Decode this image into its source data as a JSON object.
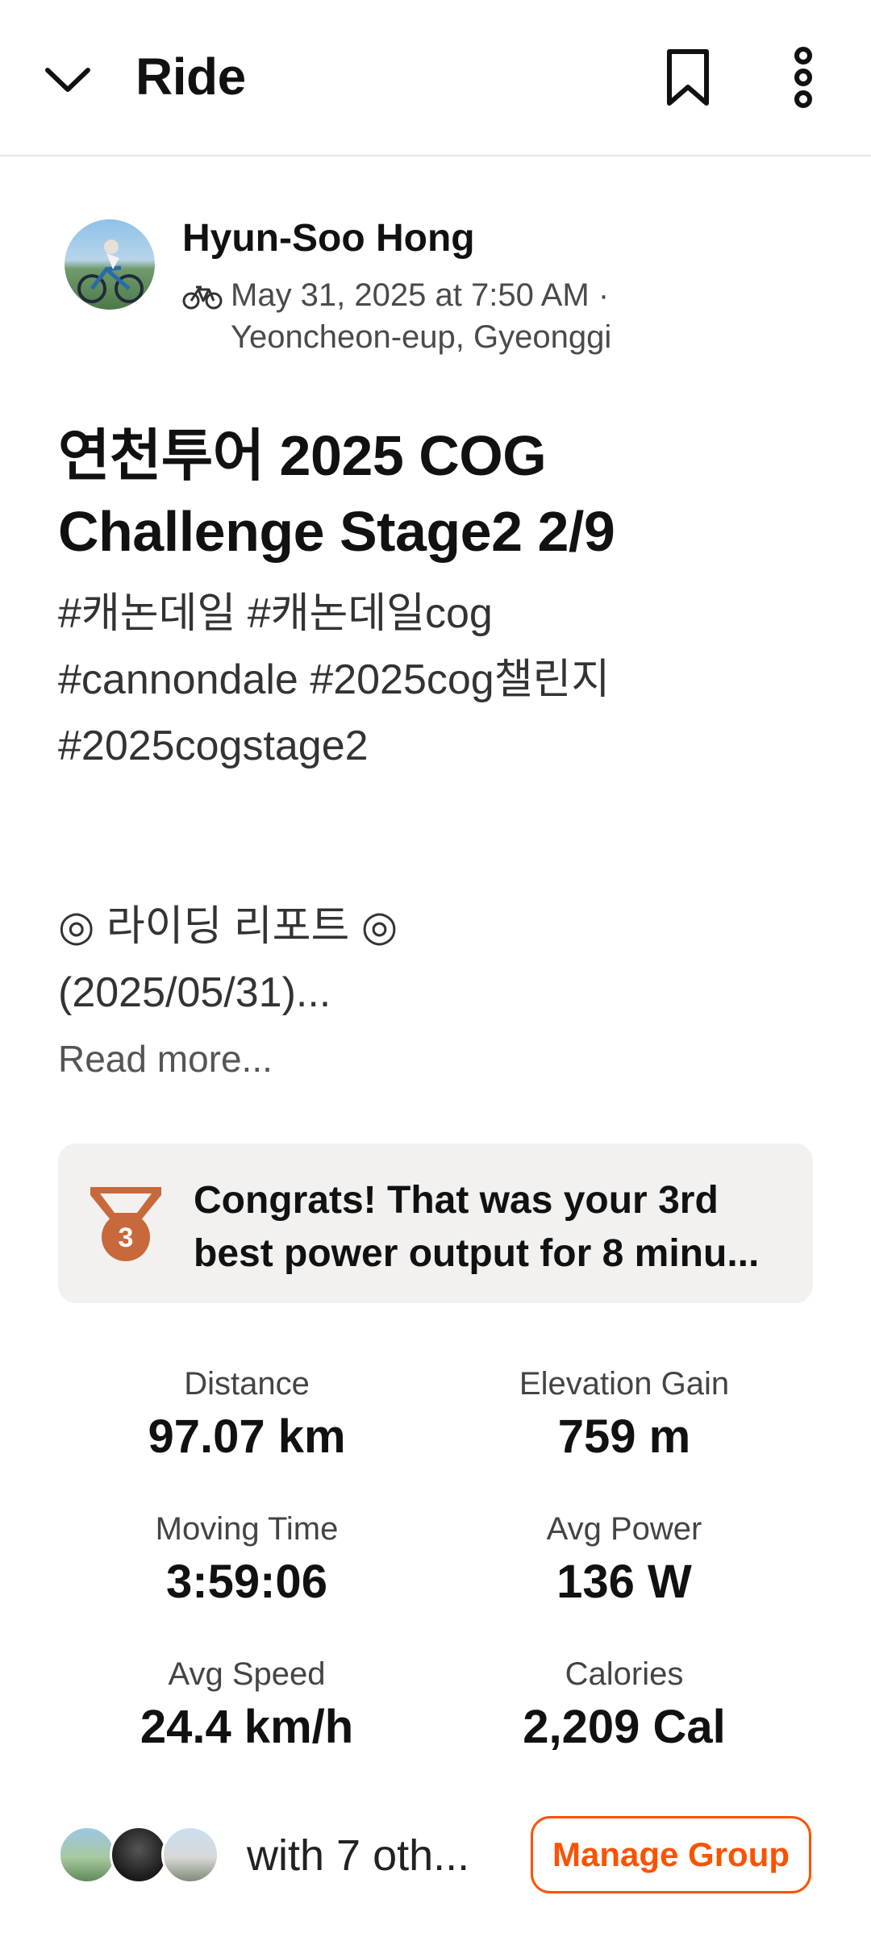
{
  "header": {
    "title": "Ride",
    "back_icon": "chevron-down-icon",
    "bookmark_icon": "bookmark-icon",
    "more_icon": "more-vertical-icon"
  },
  "athlete": {
    "name": "Hyun-Soo Hong",
    "date": "May 31, 2025 at 7:50 AM ·",
    "location": "Yeoncheon-eup, Gyeonggi",
    "activity_icon": "bike-icon"
  },
  "activity": {
    "title": "연천투어  2025 COG Challenge  Stage2  2/9",
    "hashtags": "#캐논데일 #캐논데일cog\n#cannondale #2025cog챌린지\n#2025cogstage2",
    "report": "◎ 라이딩 리포트 ◎\n(2025/05/31)...",
    "read_more": "Read more..."
  },
  "achievement": {
    "medal_rank": "3",
    "text": "Congrats! That was your 3rd best power output for 8 minu..."
  },
  "stats": [
    {
      "label": "Distance",
      "value": "97.07 km"
    },
    {
      "label": "Elevation Gain",
      "value": "759 m"
    },
    {
      "label": "Moving Time",
      "value": "3:59:06"
    },
    {
      "label": "Avg Power",
      "value": "136 W"
    },
    {
      "label": "Avg Speed",
      "value": "24.4 km/h"
    },
    {
      "label": "Calories",
      "value": "2,209 Cal"
    }
  ],
  "group": {
    "text": "with 7 oth...",
    "button": "Manage Group"
  },
  "colors": {
    "accent": "#fc5200",
    "medal": "#c8693b",
    "card_bg": "#f2f1ef"
  }
}
